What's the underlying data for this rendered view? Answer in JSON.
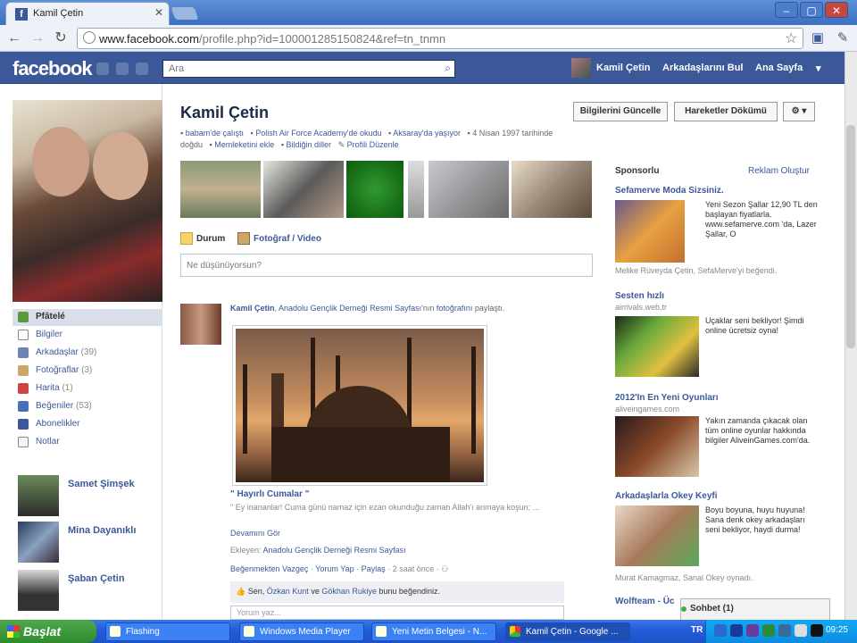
{
  "browser": {
    "tab_title": "Kamil Çetin",
    "url_host": "www.facebook.com",
    "url_path": "/profile.php?id=100001285150824&ref=tn_tnmn"
  },
  "fb_header": {
    "logo": "facebook",
    "search_placeholder": "Ara",
    "user_name": "Kamil Çetin",
    "find_friends": "Arkadaşlarını Bul",
    "home": "Ana Sayfa"
  },
  "profile": {
    "name": "Kamil Çetin",
    "update_info": "Bilgilerini Güncelle",
    "activity_log": "Hareketler Dökümü",
    "info_work": "babam'de çalıştı",
    "info_school": "Polish Air Force Academy'de okudu",
    "info_lives": "Aksaray'da yaşıyor",
    "info_born": "4 Nisan 1997 tarihinde doğdu",
    "info_hometown": "Memleketini ekle",
    "info_languages": "Bildiğin diller",
    "info_edit": "Profili Düzenle"
  },
  "left_nav": [
    {
      "label": "Pfâtelé",
      "count": ""
    },
    {
      "label": "Bilgiler",
      "count": ""
    },
    {
      "label": "Arkadaşlar",
      "count": "(39)"
    },
    {
      "label": "Fotoğraflar",
      "count": "(3)"
    },
    {
      "label": "Harita",
      "count": "(1)"
    },
    {
      "label": "Beğeniler",
      "count": "(53)"
    },
    {
      "label": "Abonelikler",
      "count": ""
    },
    {
      "label": "Notlar",
      "count": ""
    }
  ],
  "friends": [
    {
      "name": "Samet Şimşek"
    },
    {
      "name": "Mina Dayanıklı"
    },
    {
      "name": "Şaban Çetin"
    }
  ],
  "composer": {
    "tab_status": "Durum",
    "tab_photo": "Fotoğraf / Video",
    "placeholder": "Ne düşünüyorsun?"
  },
  "post": {
    "author": "Kamil Çetin",
    "page": "Anadolu Gençlik Derneği Resmi Sayfası",
    "mid": "'nın",
    "photo_word": "fotoğrafını",
    "shared": "paylaştı.",
    "caption": "\" Hayırlı Cumalar \"",
    "body": "\" Ey inananlar! Cuma günü namaz için ezan okunduğu zaman Allah'ı anmaya koşun; ...",
    "more": "Devamını Gör",
    "added_by_label": "Ekleyen:",
    "added_by": "Anadolu Gençlik Derneği Resmi Sayfası",
    "unlike": "Beğenmekten Vazgeç",
    "comment": "Yorum Yap",
    "share": "Paylaş",
    "time": "2 saat önce",
    "likes_pre": "Sen,",
    "liker1": "Özkan Kunt",
    "likes_and": "ve",
    "liker2": "Gökhan Rukiye",
    "likes_post": "bunu beğendiniz.",
    "comment_placeholder": "Yorum yaz..."
  },
  "ads": {
    "title": "Sponsorlu",
    "create": "Reklam Oluştur",
    "items": [
      {
        "title": "Sefamerve Moda Sizsiniz.",
        "source": "",
        "text": "Yeni Sezon Şallar 12,90 TL den başlayan fiyatlarla. www.sefamerve.com 'da, Lazer Şallar, O",
        "foot": "Melike Rüveyda Çetin, SefaMerve'yi beğendi."
      },
      {
        "title": "Sesten hızlı",
        "source": "airrivals.web.tr",
        "text": "Uçaklar seni bekliyor! Şimdi online ücretsiz oyna!",
        "foot": ""
      },
      {
        "title": "2012'In En Yeni Oyunları",
        "source": "aliveingames.com",
        "text": "Yakın zamanda çıkacak olan tüm online oyunlar hakkında bilgiler AliveinGames.com'da.",
        "foot": ""
      },
      {
        "title": "Arkadaşlarla Okey Keyfi",
        "source": "",
        "text": "Boyu boyuna, huyu huyuna! Sana denk okey arkadaşları seni bekliyor, haydi durma!",
        "foot": "Murat Kamagmaz, Sanal Okey oynadı."
      },
      {
        "title": "Wolfteam - Üc",
        "source": "",
        "text": "",
        "foot": ""
      }
    ]
  },
  "chat": {
    "label": "Sohbet (1)"
  },
  "taskbar": {
    "start": "Başlat",
    "tasks": [
      "Flashing",
      "Windows Media Player",
      "Yeni Metin Belgesi - N...",
      "Kamil Çetin - Google ..."
    ],
    "lang": "TR",
    "time": "09:25"
  }
}
